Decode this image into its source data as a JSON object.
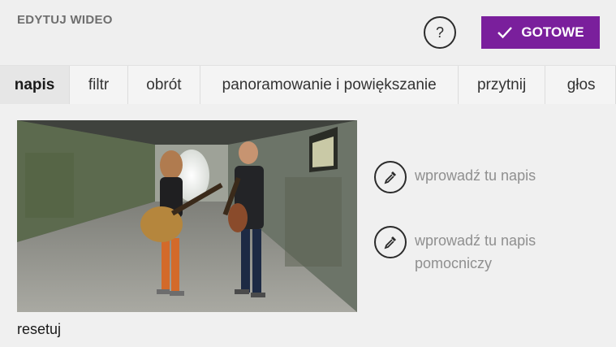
{
  "header": {
    "title": "EDYTUJ WIDEO",
    "help_label": "?",
    "done_label": "GOTOWE"
  },
  "tabs": [
    {
      "label": "napis",
      "active": true
    },
    {
      "label": "filtr",
      "active": false
    },
    {
      "label": "obrót",
      "active": false
    },
    {
      "label": "panoramowanie i powiększanie",
      "active": false
    },
    {
      "label": "przytnij",
      "active": false
    },
    {
      "label": "głos",
      "active": false
    }
  ],
  "editor": {
    "caption_placeholder": "wprowadź tu napis",
    "subcaption_placeholder": "wprowadź tu napis pomocniczy",
    "reset_label": "resetuj"
  },
  "colors": {
    "accent": "#7a1f9c",
    "background": "#f0f0f0"
  },
  "icons": [
    "checkmark-icon",
    "eyedropper-icon"
  ]
}
